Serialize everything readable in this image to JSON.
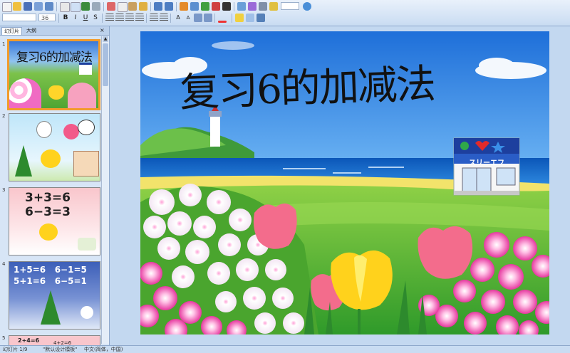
{
  "toolbar": {
    "font_name": "",
    "font_size": "36"
  },
  "panel": {
    "tabs": [
      "幻灯片",
      "大纲"
    ]
  },
  "slides": [
    {
      "number": "1",
      "title": "复习6的加减法"
    },
    {
      "number": "2"
    },
    {
      "number": "3",
      "lines": [
        "3+3=6",
        "6−3=3"
      ]
    },
    {
      "number": "4",
      "lines": [
        "1+5=6   6−1=5",
        "5+1=6   6−5=1"
      ]
    },
    {
      "number": "5",
      "lines": [
        "2+4=6",
        "4+2=6"
      ]
    }
  ],
  "main_slide": {
    "title": "复习6的加减法",
    "store_sign": "スリーエフ"
  },
  "status": {
    "slide_indicator": "幻灯片 1/9",
    "template": "\"默认设计模板\"",
    "language": "中文(简体，中国)"
  }
}
